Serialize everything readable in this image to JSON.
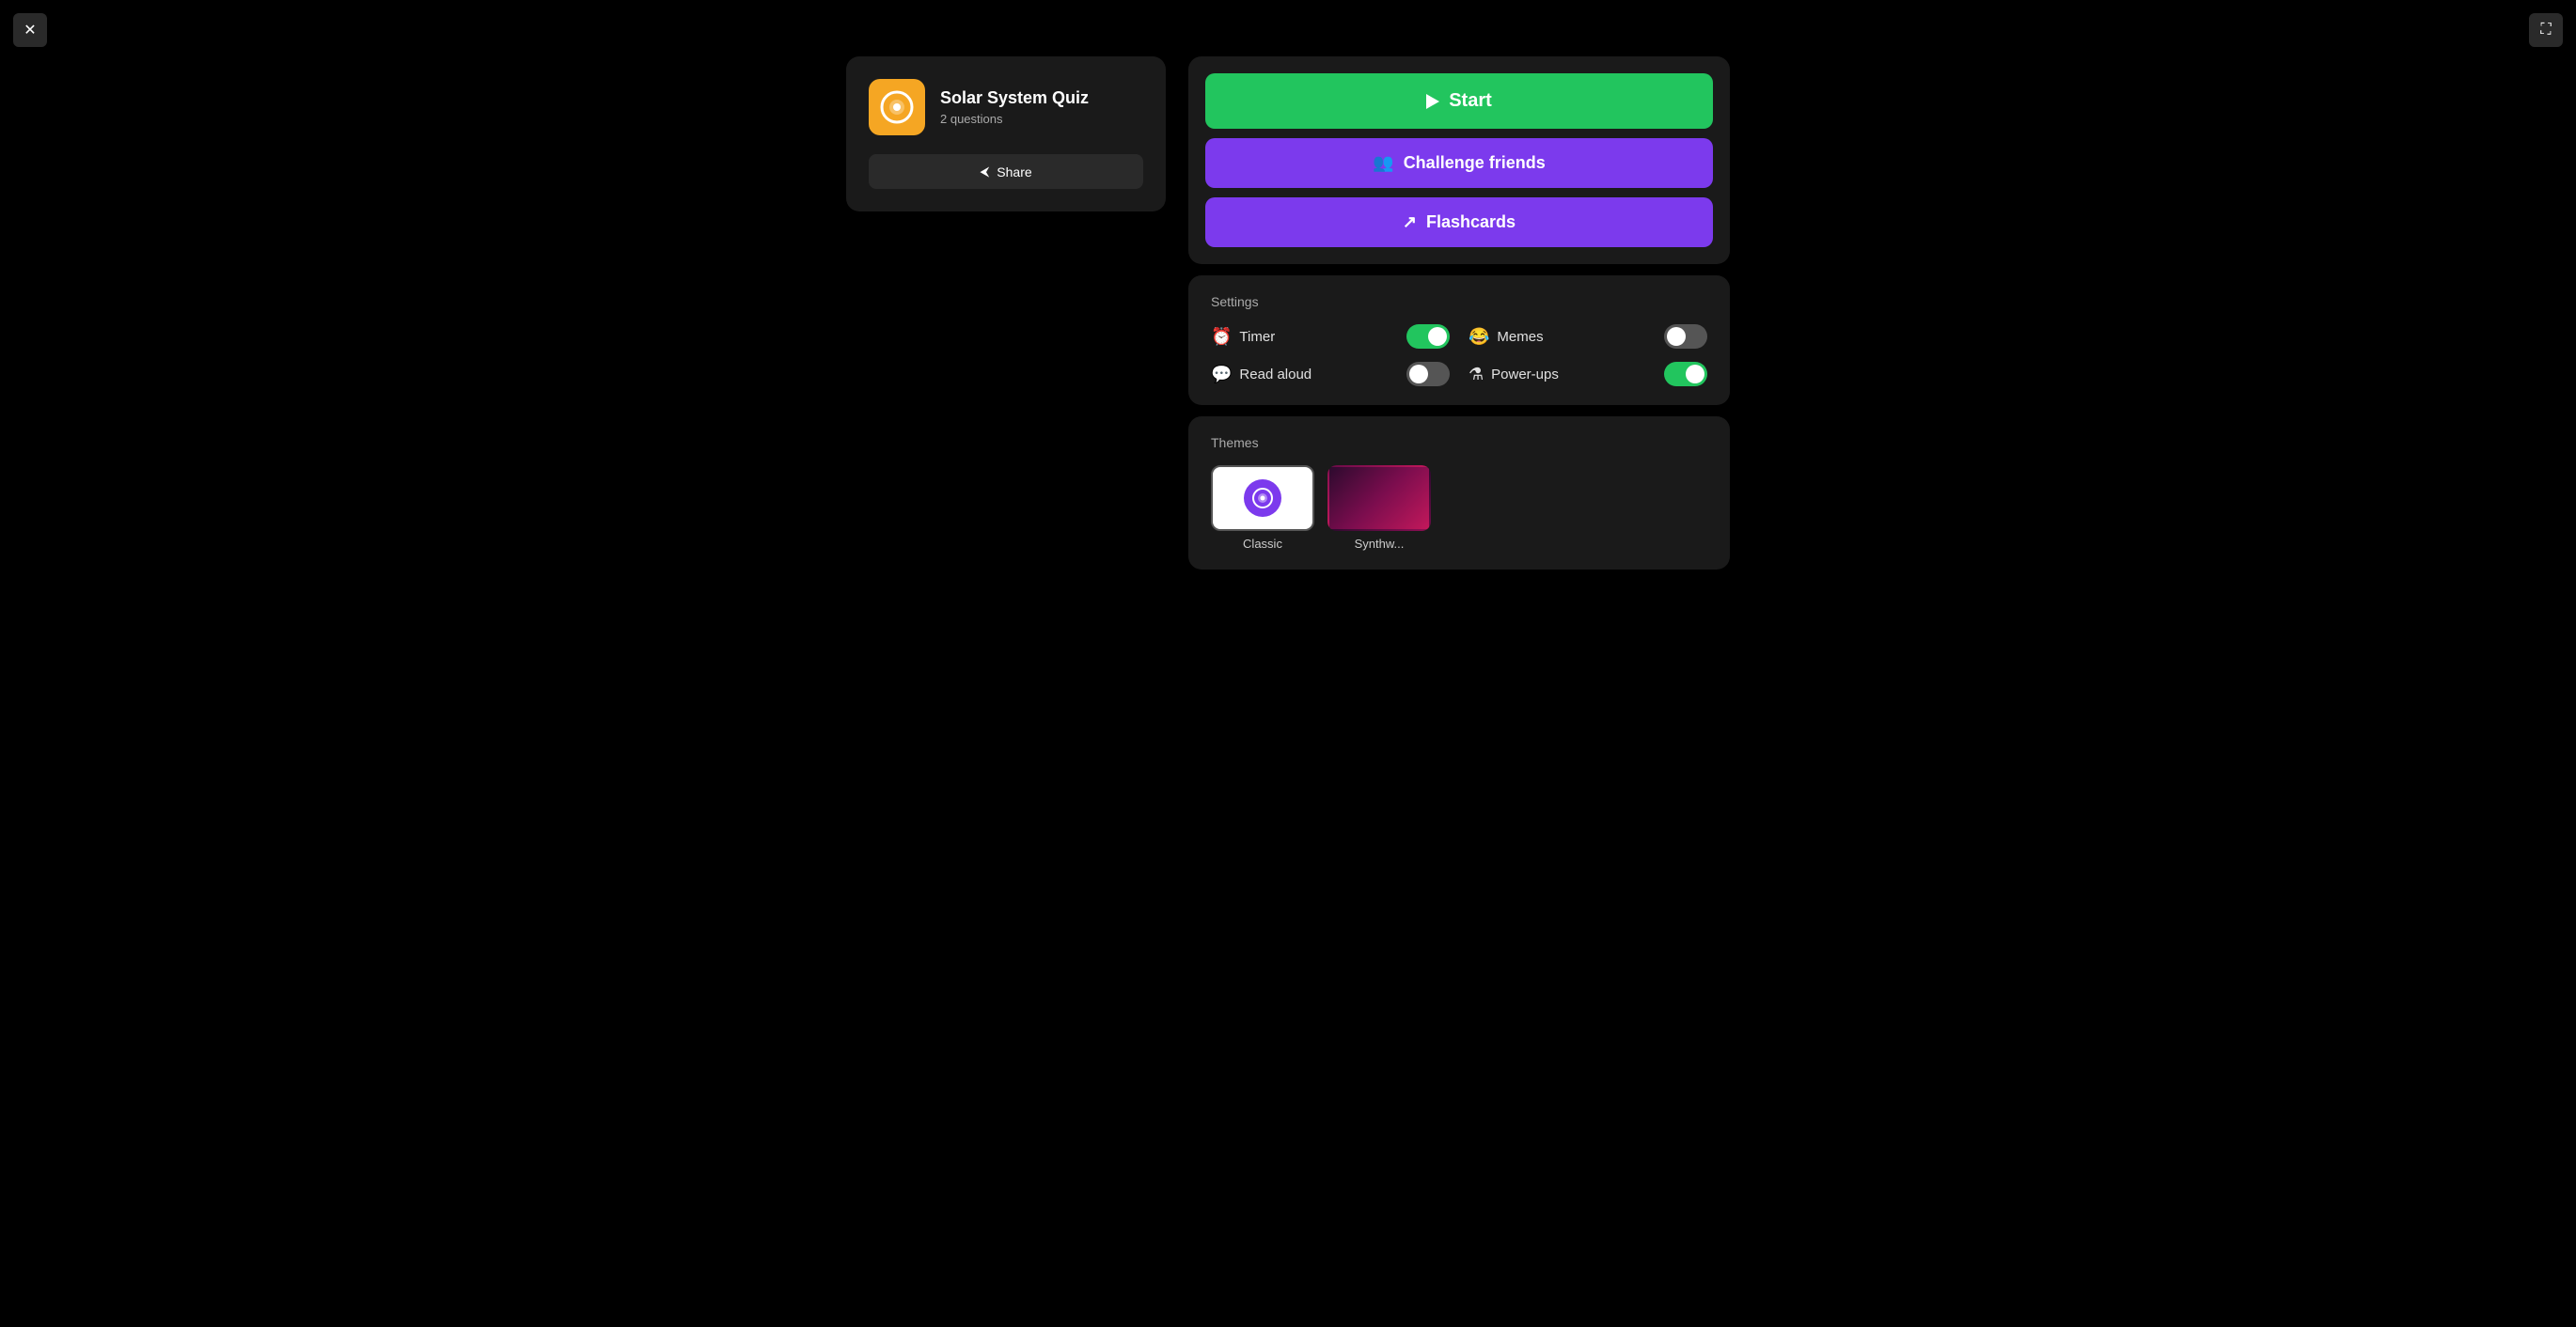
{
  "window": {
    "close_label": "✕",
    "expand_label": "⛶"
  },
  "quiz_card": {
    "icon": "Q",
    "title": "Solar System Quiz",
    "questions_count": "2 questions",
    "share_label": "Share"
  },
  "actions": {
    "start_label": "Start",
    "challenge_label": "Challenge friends",
    "flashcards_label": "Flashcards"
  },
  "settings": {
    "section_title": "Settings",
    "timer_label": "Timer",
    "timer_icon": "⏰",
    "timer_on": true,
    "memes_label": "Memes",
    "memes_icon": "😂",
    "memes_on": false,
    "read_aloud_label": "Read aloud",
    "read_aloud_icon": "💬",
    "read_aloud_on": false,
    "powerups_label": "Power-ups",
    "powerups_icon": "⚗",
    "powerups_on": true
  },
  "themes": {
    "section_title": "Themes",
    "items": [
      {
        "id": "classic",
        "label": "Classic",
        "type": "classic"
      },
      {
        "id": "synthwave",
        "label": "Synthw...",
        "type": "synthwave"
      }
    ]
  },
  "colors": {
    "green": "#22c55e",
    "purple": "#7c3aed",
    "dark_card": "#1a1a1a",
    "dark_bg": "#000"
  }
}
